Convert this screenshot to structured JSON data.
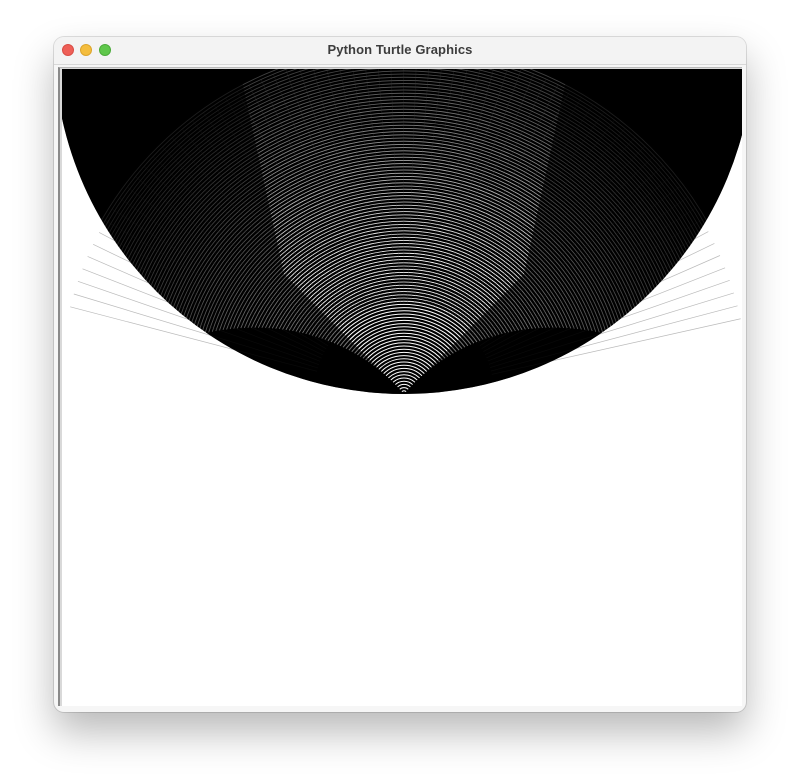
{
  "window": {
    "title": "Python Turtle Graphics"
  },
  "controls": {
    "close_icon": "close-traffic-light",
    "minimize_icon": "minimize-traffic-light",
    "zoom_icon": "zoom-traffic-light"
  },
  "colors": {
    "ink": "#000000",
    "paper": "#ffffff",
    "close": "#ee5f57",
    "minimize": "#f4bd3d",
    "zoom": "#5fc74b"
  }
}
